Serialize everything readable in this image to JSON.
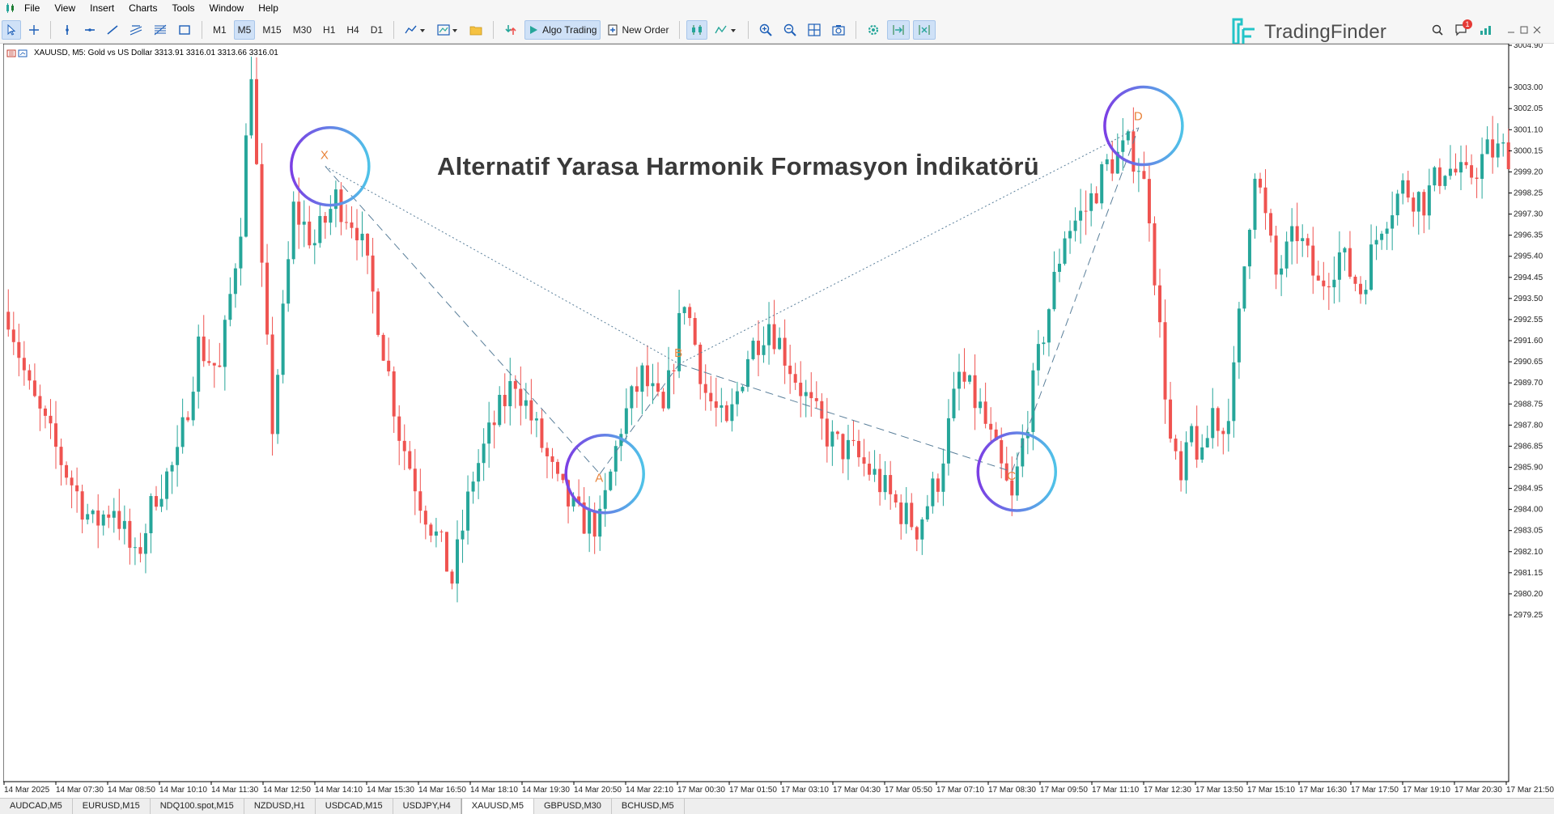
{
  "menu": [
    "File",
    "View",
    "Insert",
    "Charts",
    "Tools",
    "Window",
    "Help"
  ],
  "timeframes": [
    "M1",
    "M5",
    "M15",
    "M30",
    "H1",
    "H4",
    "D1"
  ],
  "active_timeframe": "M5",
  "toolbar": {
    "algo_trading": "Algo Trading",
    "new_order": "New Order"
  },
  "logo": {
    "text": "TradingFinder"
  },
  "notification_count": "1",
  "symbol_info": "XAUUSD, M5:  Gold vs US Dollar  3313.91 3316.01 3313.66 3316.01",
  "title": "Alternatif Yarasa Harmonik Formasyon İndikatörü",
  "pattern_points": [
    "X",
    "A",
    "B",
    "C",
    "D"
  ],
  "price_axis": [
    "3004.90",
    "3003.00",
    "3002.05",
    "3001.10",
    "3000.15",
    "2999.20",
    "2998.25",
    "2997.30",
    "2996.35",
    "2995.40",
    "2994.45",
    "2993.50",
    "2992.55",
    "2991.60",
    "2990.65",
    "2989.70",
    "2988.75",
    "2987.80",
    "2986.85",
    "2985.90",
    "2984.95",
    "2984.00",
    "2983.05",
    "2982.10",
    "2981.15",
    "2980.20",
    "2979.25"
  ],
  "time_axis": [
    "14 Mar 2025",
    "14 Mar 07:30",
    "14 Mar 08:50",
    "14 Mar 10:10",
    "14 Mar 11:30",
    "14 Mar 12:50",
    "14 Mar 14:10",
    "14 Mar 15:30",
    "14 Mar 16:50",
    "14 Mar 18:10",
    "14 Mar 19:30",
    "14 Mar 20:50",
    "14 Mar 22:10",
    "17 Mar 00:30",
    "17 Mar 01:50",
    "17 Mar 03:10",
    "17 Mar 04:30",
    "17 Mar 05:50",
    "17 Mar 07:10",
    "17 Mar 08:30",
    "17 Mar 09:50",
    "17 Mar 11:10",
    "17 Mar 12:30",
    "17 Mar 13:50",
    "17 Mar 15:10",
    "17 Mar 16:30",
    "17 Mar 17:50",
    "17 Mar 19:10",
    "17 Mar 20:30",
    "17 Mar 21:50"
  ],
  "tabs": [
    "AUDCAD,M5",
    "EURUSD,M15",
    "NDQ100.spot,M15",
    "NZDUSD,H1",
    "USDCAD,M15",
    "USDJPY,H4",
    "XAUUSD,M5",
    "GBPUSD,M30",
    "BCHUSD,M5"
  ],
  "active_tab": "XAUUSD,M5",
  "colors": {
    "bull": "#26a69a",
    "bear": "#ef5350",
    "pattern_label": "#e8833a",
    "circle_start": "#7b3fe4",
    "circle_end": "#4fc3e8"
  },
  "chart_data": {
    "type": "candlestick",
    "symbol": "XAUUSD",
    "timeframe": "M5",
    "ylim": [
      2978.5,
      3005.5
    ],
    "pattern": {
      "X": {
        "time": "14 Mar 13:40",
        "price": 2999.45
      },
      "A": {
        "time": "14 Mar 20:40",
        "price": 2985.6
      },
      "B": {
        "time": "14 Mar 22:10",
        "price": 2990.55
      },
      "C": {
        "time": "17 Mar 09:50",
        "price": 2985.7
      },
      "D": {
        "time": "17 Mar 12:50",
        "price": 3001.2
      }
    },
    "candle_path": [
      [
        0,
        2992.9
      ],
      [
        4,
        2989.3
      ],
      [
        8,
        2987.2
      ],
      [
        12,
        2985.2
      ],
      [
        16,
        2983.3
      ],
      [
        20,
        2984.2
      ],
      [
        24,
        2981.6
      ],
      [
        28,
        2984.8
      ],
      [
        32,
        2986.2
      ],
      [
        36,
        2991.4
      ],
      [
        40,
        2990.2
      ],
      [
        44,
        2997.0
      ],
      [
        46,
        3004.0
      ],
      [
        48,
        2994.5
      ],
      [
        50,
        2987.8
      ],
      [
        54,
        2997.5
      ],
      [
        58,
        2996.0
      ],
      [
        62,
        2998.0
      ],
      [
        66,
        2996.8
      ],
      [
        70,
        2992.6
      ],
      [
        74,
        2987.5
      ],
      [
        78,
        2984.5
      ],
      [
        82,
        2982.2
      ],
      [
        84,
        2980.8
      ],
      [
        88,
        2985.5
      ],
      [
        92,
        2987.9
      ],
      [
        96,
        2989.9
      ],
      [
        100,
        2987.5
      ],
      [
        104,
        2985.0
      ],
      [
        108,
        2983.6
      ],
      [
        112,
        2983.3
      ],
      [
        116,
        2987.8
      ],
      [
        120,
        2990.0
      ],
      [
        124,
        2988.2
      ],
      [
        128,
        2993.6
      ],
      [
        132,
        2989.3
      ],
      [
        136,
        2987.5
      ],
      [
        140,
        2991.0
      ],
      [
        144,
        2992.5
      ],
      [
        148,
        2990.5
      ],
      [
        152,
        2988.5
      ],
      [
        156,
        2987.0
      ],
      [
        160,
        2986.5
      ],
      [
        164,
        2985.5
      ],
      [
        168,
        2984.2
      ],
      [
        172,
        2983.2
      ],
      [
        176,
        2985.4
      ],
      [
        180,
        2990.0
      ],
      [
        184,
        2988.5
      ],
      [
        188,
        2985.7
      ],
      [
        190,
        2984.3
      ],
      [
        192,
        2987.0
      ],
      [
        196,
        2992.0
      ],
      [
        200,
        2996.5
      ],
      [
        204,
        2997.5
      ],
      [
        208,
        2999.5
      ],
      [
        212,
        3000.3
      ],
      [
        214,
        2999.6
      ],
      [
        216,
        2997.5
      ],
      [
        218,
        2992.0
      ],
      [
        220,
        2987.0
      ],
      [
        222,
        2985.0
      ],
      [
        224,
        2987.5
      ],
      [
        226,
        2986.0
      ],
      [
        228,
        2988.5
      ],
      [
        230,
        2987.5
      ],
      [
        232,
        2990.0
      ],
      [
        234,
        2995.0
      ],
      [
        236,
        2999.5
      ],
      [
        238,
        2997.0
      ],
      [
        240,
        2994.5
      ],
      [
        244,
        2996.5
      ],
      [
        248,
        2994.0
      ],
      [
        252,
        2995.5
      ],
      [
        256,
        2993.9
      ],
      [
        260,
        2997.0
      ],
      [
        264,
        2998.5
      ],
      [
        268,
        2997.9
      ],
      [
        272,
        2999.5
      ],
      [
        276,
        2998.8
      ],
      [
        280,
        3000.1
      ]
    ]
  }
}
